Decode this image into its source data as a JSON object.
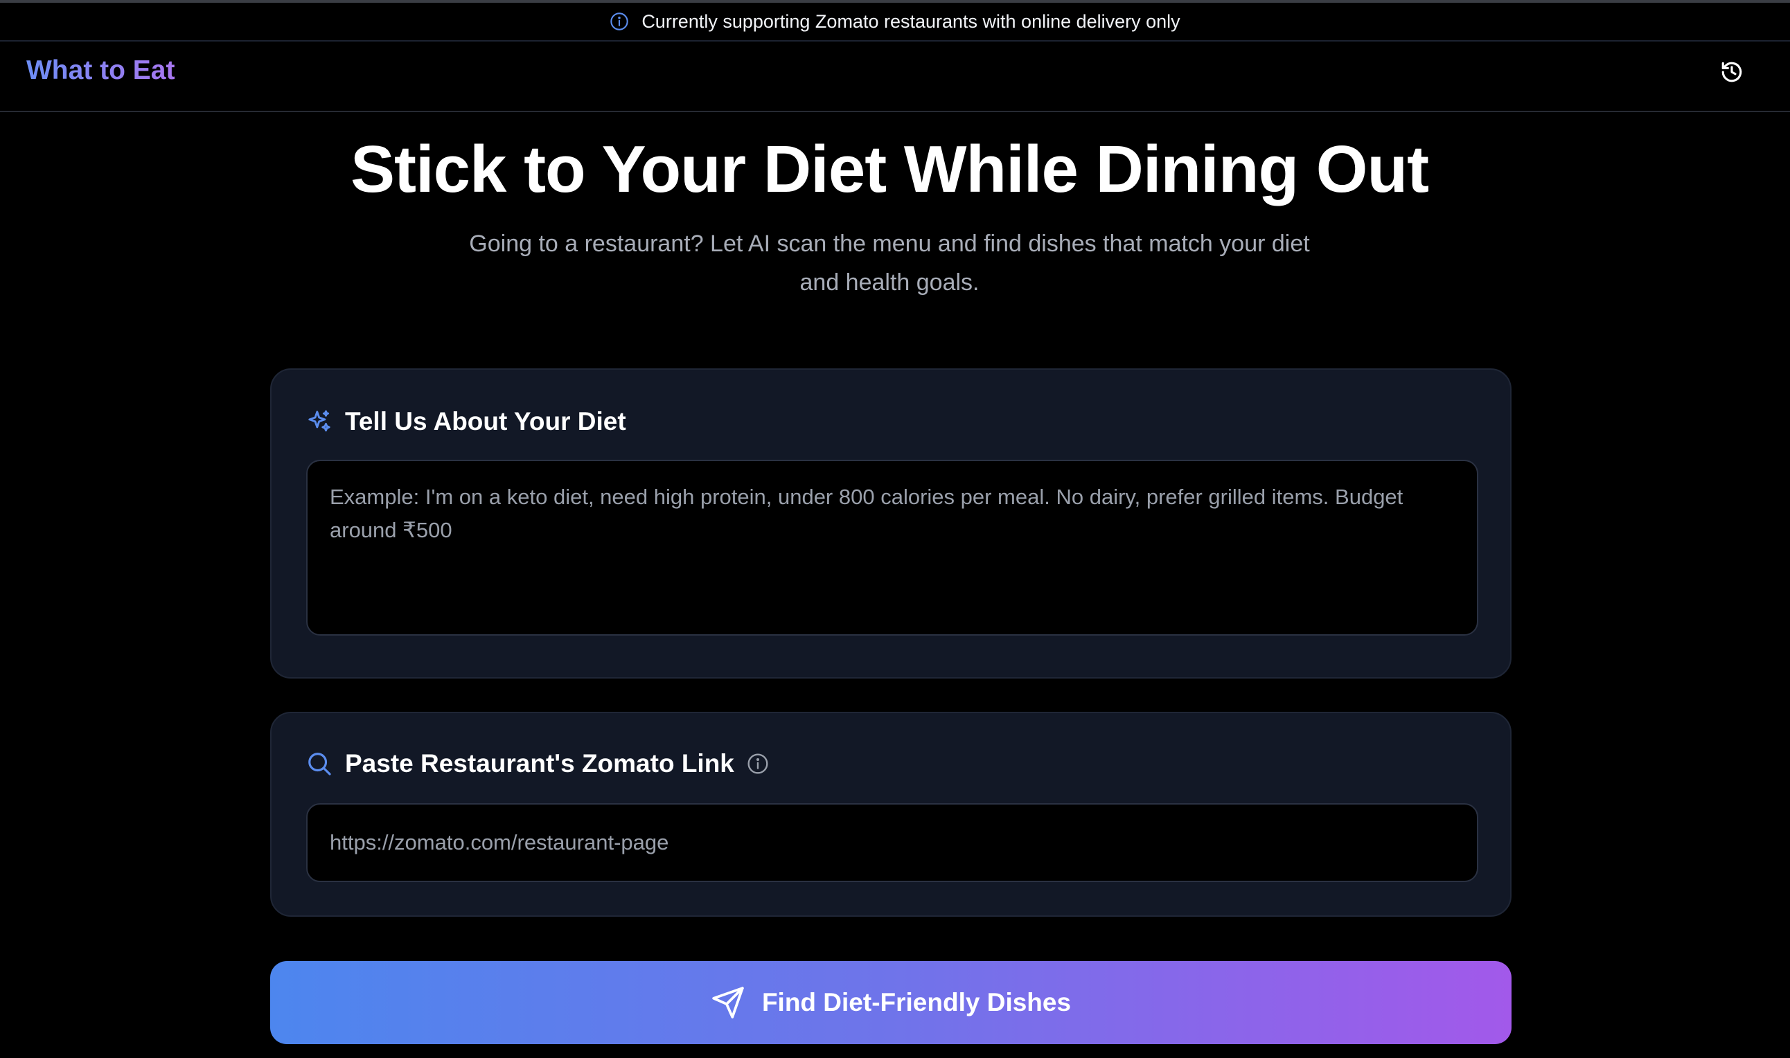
{
  "banner": {
    "icon": "info-icon",
    "text": "Currently supporting Zomato restaurants with online delivery only"
  },
  "nav": {
    "brand": "What to Eat",
    "history_icon": "history-icon"
  },
  "hero": {
    "title": "Stick to Your Diet While Dining Out",
    "subtitle_line1": "Going to a restaurant? Let AI scan the menu and find dishes that match your diet",
    "subtitle_line2": "and health goals."
  },
  "diet_card": {
    "icon": "sparkles-icon",
    "title": "Tell Us About Your Diet",
    "value": "",
    "placeholder": "Example: I'm on a keto diet, need high protein, under 800 calories per meal. No dairy, prefer grilled items. Budget around ₹500"
  },
  "link_card": {
    "icon": "search-icon",
    "title": "Paste Restaurant's Zomato Link",
    "info_icon": "info-icon",
    "value": "",
    "placeholder": "https://zomato.com/restaurant-page"
  },
  "submit": {
    "icon": "send-icon",
    "label": "Find Diet-Friendly Dishes"
  },
  "colors": {
    "background": "#000000",
    "card": "#121826",
    "brand_gradient_start": "#6d8ef5",
    "brand_gradient_end": "#a877f0",
    "accent_blue": "#5b8def",
    "button_gradient_start": "#4d86ee",
    "button_gradient_end": "#a259ea"
  }
}
